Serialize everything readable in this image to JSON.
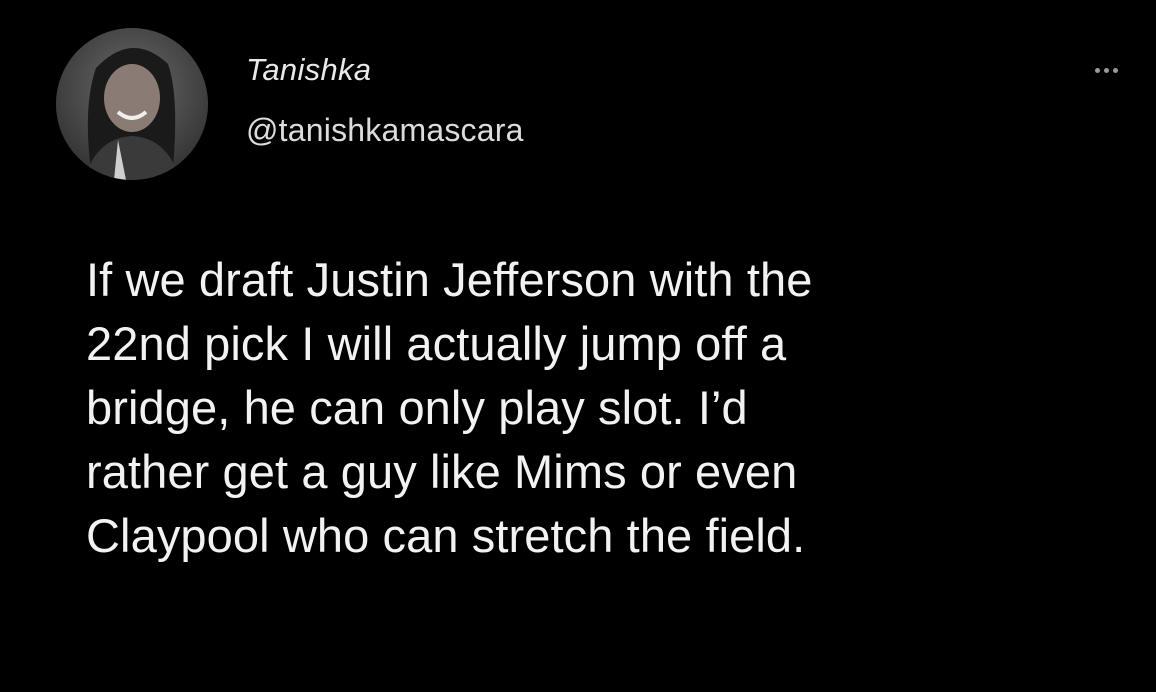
{
  "tweet": {
    "author": {
      "display_name": "Tanishka",
      "handle": "@tanishkamascara",
      "avatar_icon": "user-avatar"
    },
    "more_icon": "ellipsis-icon",
    "text": "If we draft Justin Jefferson with the\n22nd pick I will actually jump off a\nbridge, he can only play slot. I’d\nrather get a guy like Mims or even\nClaypool who can stretch the field."
  },
  "colors": {
    "background": "#000000",
    "text": "#f2f2f2",
    "muted": "#9a9a9a"
  }
}
